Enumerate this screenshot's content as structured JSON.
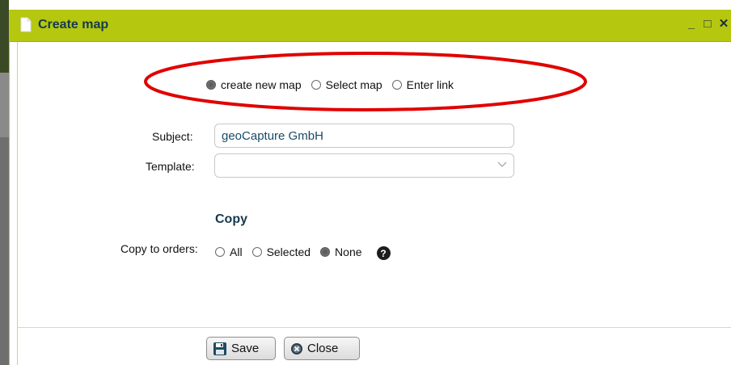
{
  "window": {
    "title": "Create map",
    "minimize_glyph": "_",
    "maximize_glyph": "□",
    "close_glyph": "✕"
  },
  "mode": {
    "options": [
      {
        "label": "create new map",
        "checked": true
      },
      {
        "label": "Select map",
        "checked": false
      },
      {
        "label": "Enter link",
        "checked": false
      }
    ]
  },
  "form": {
    "subject_label": "Subject:",
    "subject_value": "geoCapture GmbH",
    "template_label": "Template:",
    "template_value": ""
  },
  "copy": {
    "section_title": "Copy",
    "label": "Copy to orders:",
    "options": [
      {
        "label": "All",
        "checked": false
      },
      {
        "label": "Selected",
        "checked": false
      },
      {
        "label": "None",
        "checked": true
      }
    ],
    "help_glyph": "?"
  },
  "buttons": {
    "save_label": "Save",
    "close_label": "Close"
  },
  "colors": {
    "titlebar": "#b5c70f",
    "title_text": "#163a4e",
    "annotation_ellipse": "#e00000"
  },
  "icons": {
    "title": "document-icon",
    "save": "floppy-disk-icon",
    "close": "close-circle-icon",
    "help": "question-circle-icon"
  }
}
